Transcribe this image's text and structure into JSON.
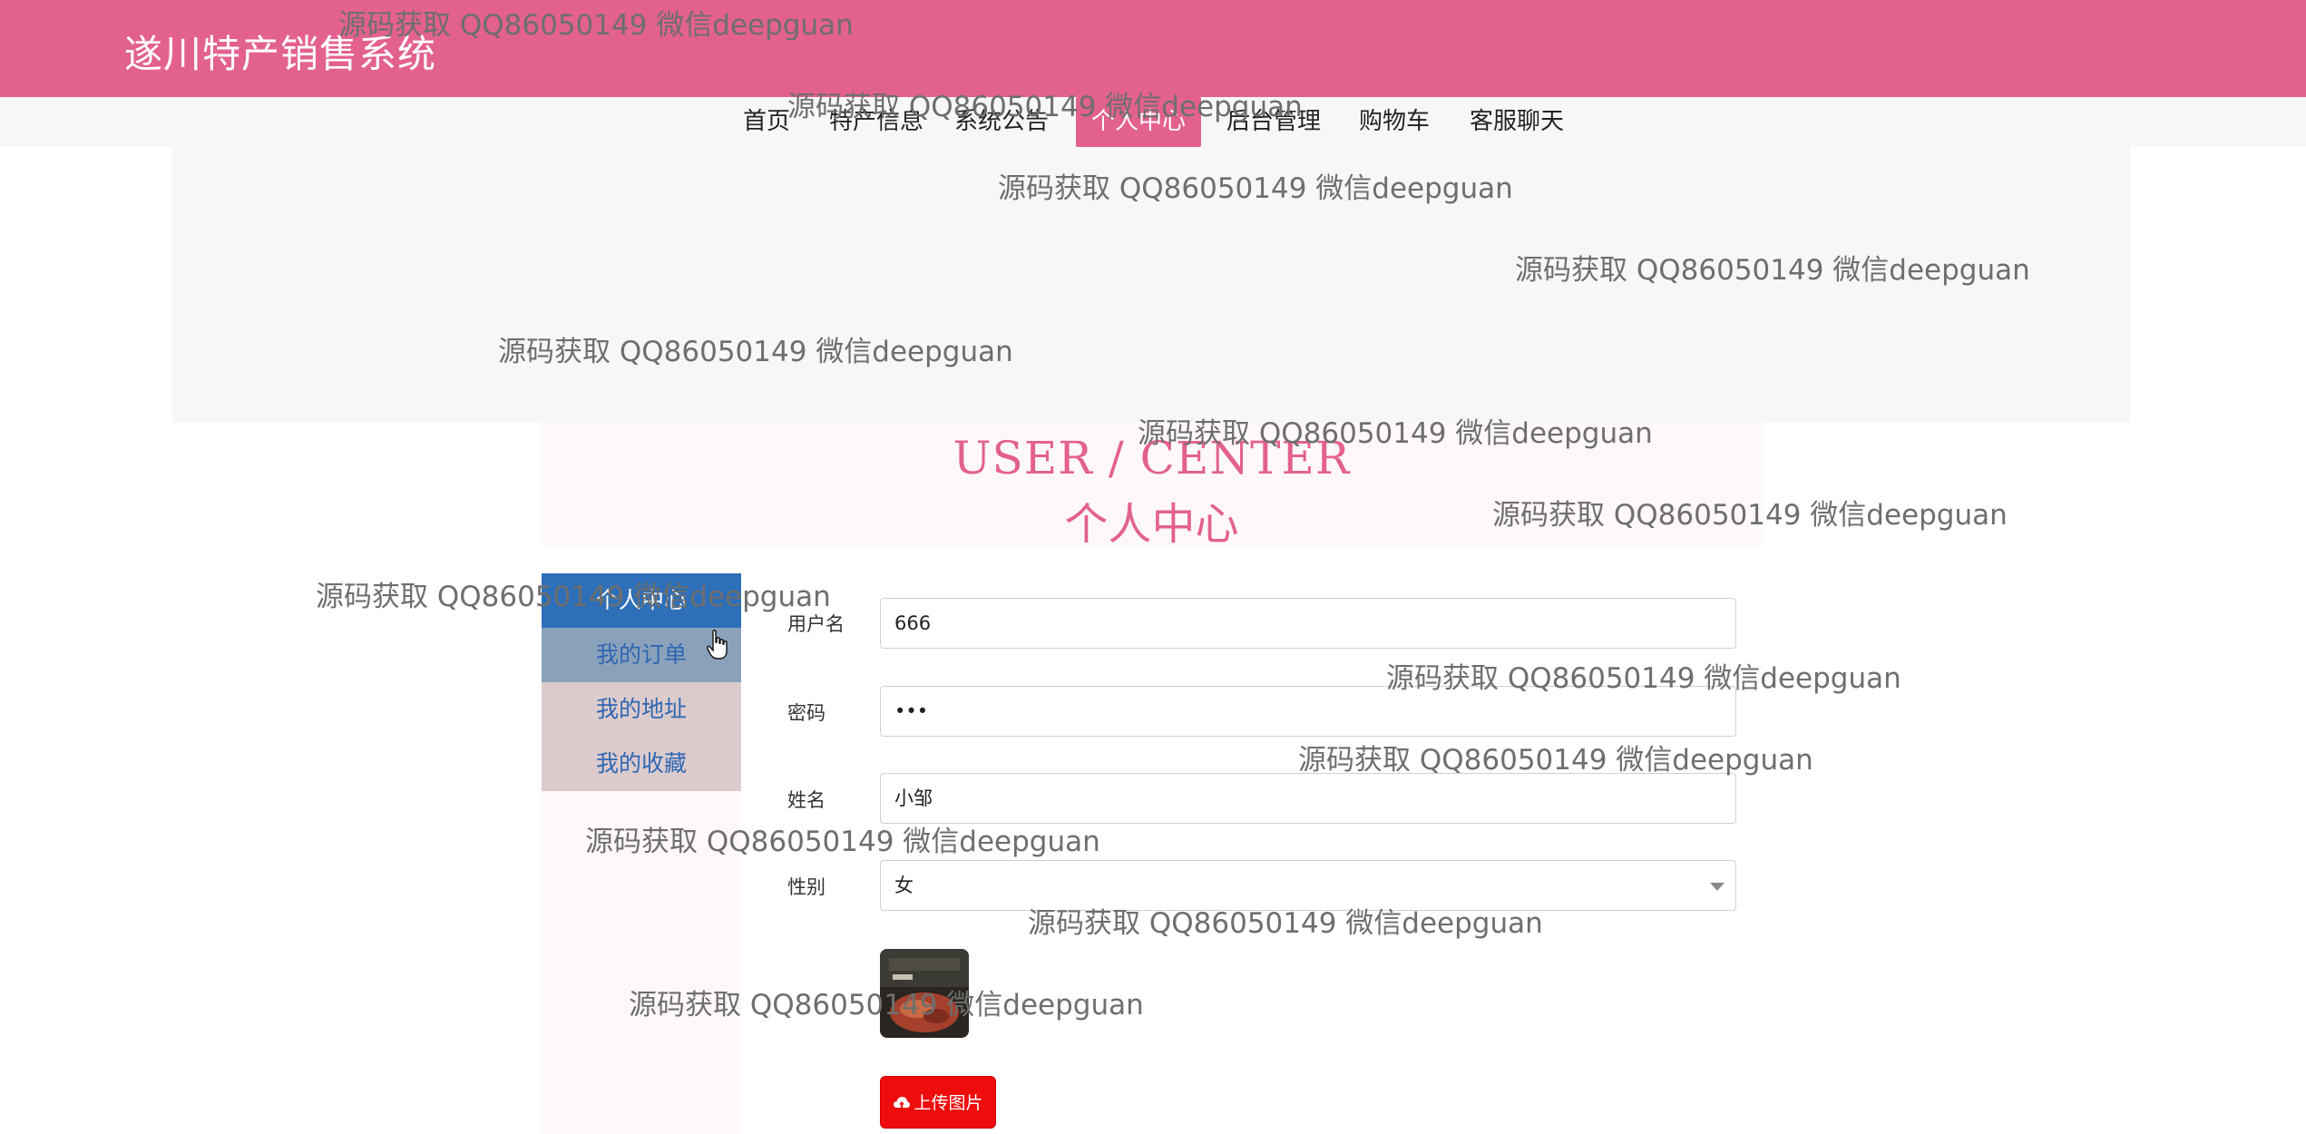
{
  "app": {
    "title": "遂川特产销售系统"
  },
  "nav": {
    "items": [
      {
        "label": "首页"
      },
      {
        "label": "特产信息"
      },
      {
        "label": "系统公告"
      },
      {
        "label": "个人中心",
        "active": true
      },
      {
        "label": "后台管理"
      },
      {
        "label": "购物车"
      },
      {
        "label": "客服聊天"
      }
    ]
  },
  "page": {
    "title_en": "USER / CENTER",
    "title_cn": "个人中心"
  },
  "sidebar": {
    "items": [
      {
        "label": "个人中心",
        "state": "active"
      },
      {
        "label": "我的订单",
        "state": "hover"
      },
      {
        "label": "我的地址"
      },
      {
        "label": "我的收藏"
      }
    ]
  },
  "form": {
    "username": {
      "label": "用户名",
      "value": "666"
    },
    "password": {
      "label": "密码",
      "value": "•••"
    },
    "name": {
      "label": "姓名",
      "value": "小邹"
    },
    "gender": {
      "label": "性别",
      "value": "女"
    },
    "upload_label": "上传图片"
  },
  "watermark": {
    "text": "源码获取 QQ86050149 微信deepguan"
  },
  "colors": {
    "brand": "#e3618f",
    "sidebar_active": "#2d6fb8",
    "sidebar_item": "#dccbcc",
    "upload_button": "#ee0c0c"
  }
}
